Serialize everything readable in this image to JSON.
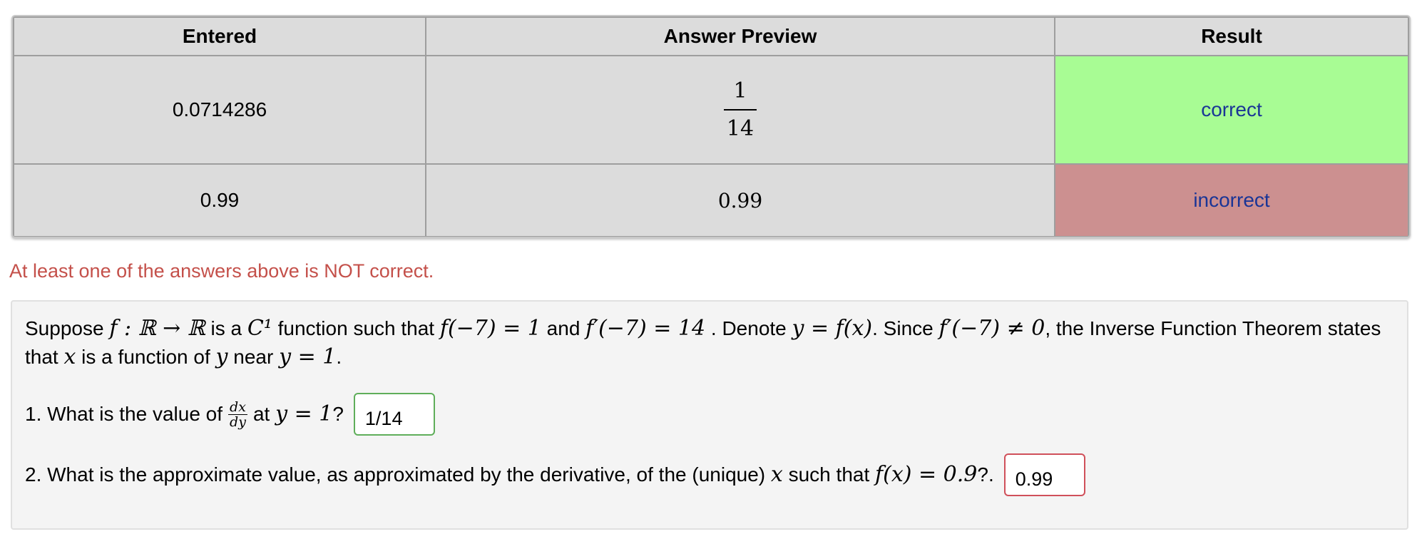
{
  "results_table": {
    "headers": [
      "Entered",
      "Answer Preview",
      "Result"
    ],
    "rows": [
      {
        "entered": "0.0714286",
        "preview_numerator": "1",
        "preview_denominator": "14",
        "result": "correct"
      },
      {
        "entered": "0.99",
        "preview": "0.99",
        "result": "incorrect"
      }
    ]
  },
  "colors": {
    "correct_bg": "#a8fc94",
    "incorrect_bg": "#cc9090",
    "warning_text": "#c4504a",
    "result_text": "#1a3596"
  },
  "warning": "At least one of the answers above is NOT correct.",
  "problem": {
    "statement_parts": {
      "p1": "Suppose ",
      "m1": "f : ℝ → ℝ",
      "p2": " is a ",
      "m2": "C¹",
      "p3": " function such that ",
      "m3": "f(−7) = 1",
      "p4": " and ",
      "m4": "f′(−7) = 14",
      "p5": " . Denote ",
      "m5": "y = f(x)",
      "p6": ". Since ",
      "m6": "f′(−7) ≠ 0",
      "p7": ", the Inverse Function Theorem states that ",
      "m7": "x",
      "p8": " is a function of ",
      "m8": "y",
      "p9": " near ",
      "m9": "y = 1",
      "p10": "."
    },
    "q1": {
      "prefix": "1. What is the value of",
      "frac_num": "dx",
      "frac_den": "dy",
      "mid": "at",
      "math": "y = 1",
      "suffix": "?",
      "answer": "1/14"
    },
    "q2": {
      "prefix": "2. What is the approximate value, as approximated by the derivative, of the (unique)",
      "math_x": "x",
      "mid": "such that",
      "math": "f(x) = 0.9",
      "suffix": "?.",
      "answer": "0.99"
    }
  }
}
